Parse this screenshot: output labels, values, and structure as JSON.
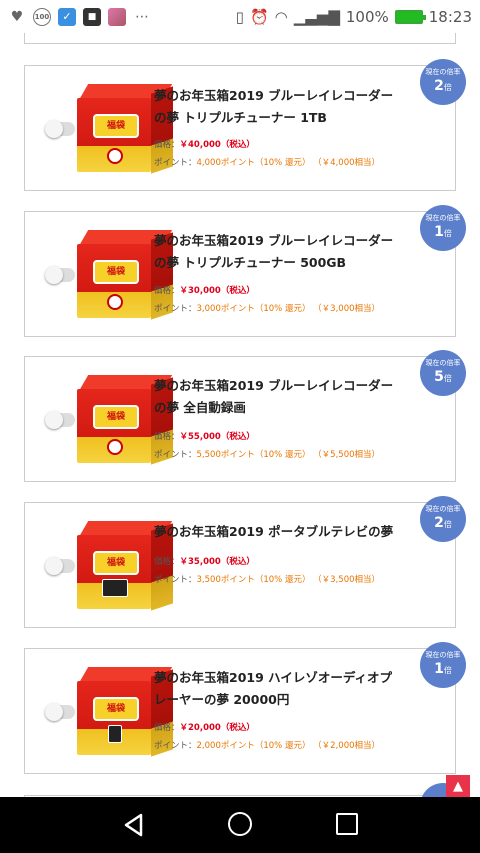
{
  "status_bar": {
    "icons": [
      "heartbeat-icon",
      "badge-100-icon",
      "shield-app-icon",
      "notification-app-icon",
      "anime-app-icon",
      "more-icon"
    ],
    "badge_text": "100",
    "right_icons": [
      "vibrate-icon",
      "alarm-icon",
      "wifi-icon",
      "signal-icon"
    ],
    "battery": "100%",
    "time": "18:23"
  },
  "labels": {
    "price_prefix": "価格：",
    "point_prefix": "ポイント：",
    "rate_label": "現在の倍率",
    "rate_unit": "倍",
    "tax_note": "（税込）",
    "return_note": "（10% 還元）"
  },
  "products": [
    {
      "title": "夢のお年玉箱2019 ブルーレイレコーダーの夢 トリプルチューナー 1TB",
      "price": "￥40,000",
      "points": "4,000ポイント",
      "points_value": "（￥4,000相当）",
      "rate": "2",
      "image": "fukubukuro-box-recorder"
    },
    {
      "title": "夢のお年玉箱2019 ブルーレイレコーダーの夢 トリプルチューナー 500GB",
      "price": "￥30,000",
      "points": "3,000ポイント",
      "points_value": "（￥3,000相当）",
      "rate": "1",
      "image": "fukubukuro-box-recorder"
    },
    {
      "title": "夢のお年玉箱2019 ブルーレイレコーダーの夢 全自動録画",
      "price": "￥55,000",
      "points": "5,500ポイント",
      "points_value": "（￥5,500相当）",
      "rate": "5",
      "image": "fukubukuro-box-recorder"
    },
    {
      "title": "夢のお年玉箱2019 ポータブルテレビの夢",
      "price": "￥35,000",
      "points": "3,500ポイント",
      "points_value": "（￥3,500相当）",
      "rate": "2",
      "image": "fukubukuro-box-tv"
    },
    {
      "title": "夢のお年玉箱2019 ハイレゾオーディオプレーヤーの夢 20000円",
      "price": "￥20,000",
      "points": "2,000ポイント",
      "points_value": "（￥2,000相当）",
      "rate": "1",
      "image": "fukubukuro-box-audio"
    }
  ],
  "scroll_top_icon": "chevron-up-icon",
  "nav": [
    "back-icon",
    "home-icon",
    "recents-icon"
  ]
}
